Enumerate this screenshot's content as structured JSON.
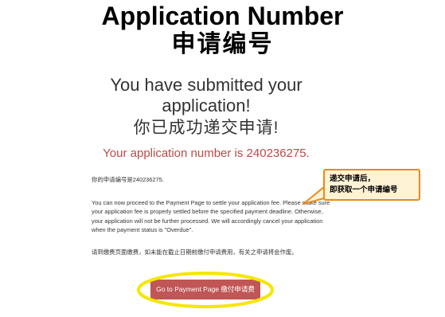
{
  "header": {
    "title_en": "Application Number",
    "title_zh": "申请编号"
  },
  "confirmation": {
    "line1": "You have submitted your",
    "line2": "application!",
    "line3": "你已成功递交申请!",
    "application_number_text": "Your application number is 240236275."
  },
  "body": {
    "para0": "你的申请编号是240236275.",
    "para1": "You can now proceed to the Payment Page to settle your application fee. Please make sure your application fee is properly settled before the specified payment deadline. Otherwise, your application will not be further processed. We will accordingly cancel your application when the payment status is \"Overdue\".",
    "para2": "请到缴费页面缴费，如未能在截止日期前缴付申请费用，有关之申请将会作废。"
  },
  "callout": {
    "line1": "递交申请后，",
    "line2": "即获取一个申请编号"
  },
  "button": {
    "label": "Go to Payment Page 缴付申请费"
  },
  "colors": {
    "accent_red": "#b94a48",
    "button_bg": "#c05656",
    "highlight_yellow": "#f5e600",
    "callout_border": "#e8891e"
  }
}
